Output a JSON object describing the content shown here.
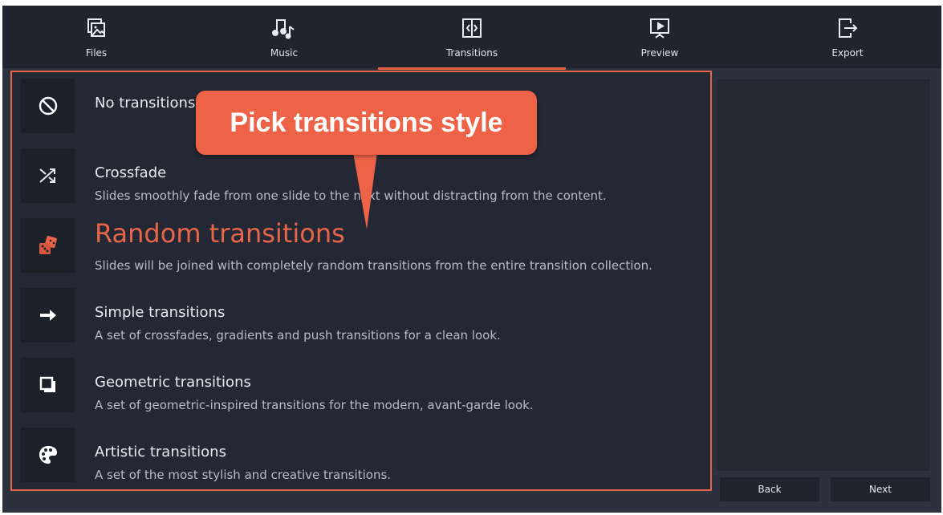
{
  "nav": {
    "tabs": [
      {
        "label": "Files",
        "icon": "files-icon"
      },
      {
        "label": "Music",
        "icon": "music-icon"
      },
      {
        "label": "Transitions",
        "icon": "transitions-icon",
        "active": true
      },
      {
        "label": "Preview",
        "icon": "preview-icon"
      },
      {
        "label": "Export",
        "icon": "export-icon"
      }
    ]
  },
  "transitions": [
    {
      "title": "No transitions",
      "description": "",
      "icon": "no-transition-icon"
    },
    {
      "title": "Crossfade",
      "description": "Slides smoothly fade from one slide to the next without distracting from the content.",
      "icon": "shuffle-icon"
    },
    {
      "title": "Random transitions",
      "description": "Slides will be joined with completely random transitions from the entire transition collection.",
      "icon": "dice-icon",
      "selected": true
    },
    {
      "title": "Simple transitions",
      "description": "A set of crossfades, gradients and push transitions for a clean look.",
      "icon": "arrow-right-icon"
    },
    {
      "title": "Geometric transitions",
      "description": "A set of geometric-inspired transitions for the modern, avant-garde look.",
      "icon": "squares-icon"
    },
    {
      "title": "Artistic transitions",
      "description": "A set of the most stylish and creative transitions.",
      "icon": "palette-icon"
    }
  ],
  "callout": {
    "text": "Pick transitions style"
  },
  "buttons": {
    "back": "Back",
    "next": "Next"
  },
  "colors": {
    "accent": "#e8654a",
    "background": "#2b313d",
    "nav": "#1f242e"
  }
}
